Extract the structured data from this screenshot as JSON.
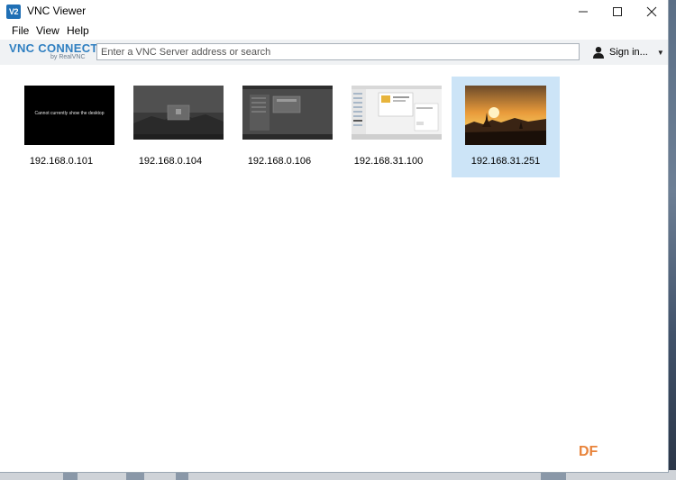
{
  "window": {
    "title": "VNC Viewer",
    "icon_label": "V2",
    "controls": {
      "minimize": "—",
      "maximize": "☐",
      "close": "✕"
    }
  },
  "menu": [
    {
      "label": "File"
    },
    {
      "label": "View"
    },
    {
      "label": "Help"
    }
  ],
  "toolbar": {
    "logo_main": "VNC CONNECT",
    "logo_sub": "by RealVNC",
    "search_placeholder": "Enter a VNC Server address or search",
    "search_value": "",
    "signin_label": "Sign in...",
    "signin_caret": "▼"
  },
  "connections": [
    {
      "label": "192.168.0.101",
      "thumb_text": "Cannot currently show the desktop",
      "selected": false
    },
    {
      "label": "192.168.0.104",
      "selected": false
    },
    {
      "label": "192.168.0.106",
      "selected": false
    },
    {
      "label": "192.168.31.100",
      "selected": false
    },
    {
      "label": "192.168.31.251",
      "selected": true
    }
  ],
  "watermark": "DF",
  "colors": {
    "brand": "#2f7fc1",
    "selection": "#cce4f7",
    "watermark": "#e8833a"
  }
}
